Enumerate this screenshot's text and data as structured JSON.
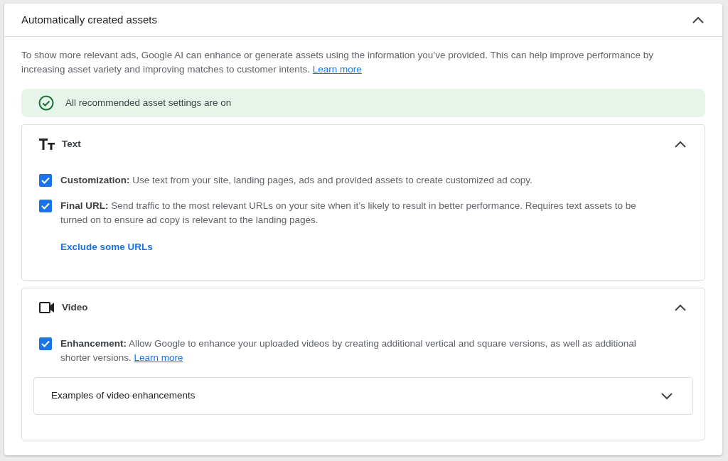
{
  "panel": {
    "title": "Automatically created assets",
    "expanded": true,
    "description": "To show more relevant ads, Google AI can enhance or generate assets using the information you’ve provided. This can help improve performance by increasing asset variety and improving matches to customer intents.",
    "description_link": "Learn more",
    "status": "All recommended asset settings are on"
  },
  "sections": [
    {
      "kind": "text",
      "title": "Text",
      "expanded": true,
      "options": [
        {
          "text": "**Customization:** Use text from your site, landing pages, ads and provided assets to create customized ad copy.",
          "checked": true
        },
        {
          "text": "**Final URL:** Send traffic to the most relevant URLs on your site when it’s likely to result in better performance. Requires text assets to be turned on to ensure ad copy is relevant to the landing pages.",
          "checked": true
        }
      ],
      "action_link": "Exclude some URLs"
    },
    {
      "kind": "video",
      "title": "Video",
      "expanded": true,
      "options": [
        {
          "text": "**Enhancement:** Allow Google to enhance your uploaded videos by creating additional vertical and square versions, as well as additional shorter versions.",
          "checked": true,
          "link": "Learn more"
        }
      ],
      "subpanel": {
        "title": "Examples of video enhancements",
        "expanded": false
      }
    }
  ]
}
